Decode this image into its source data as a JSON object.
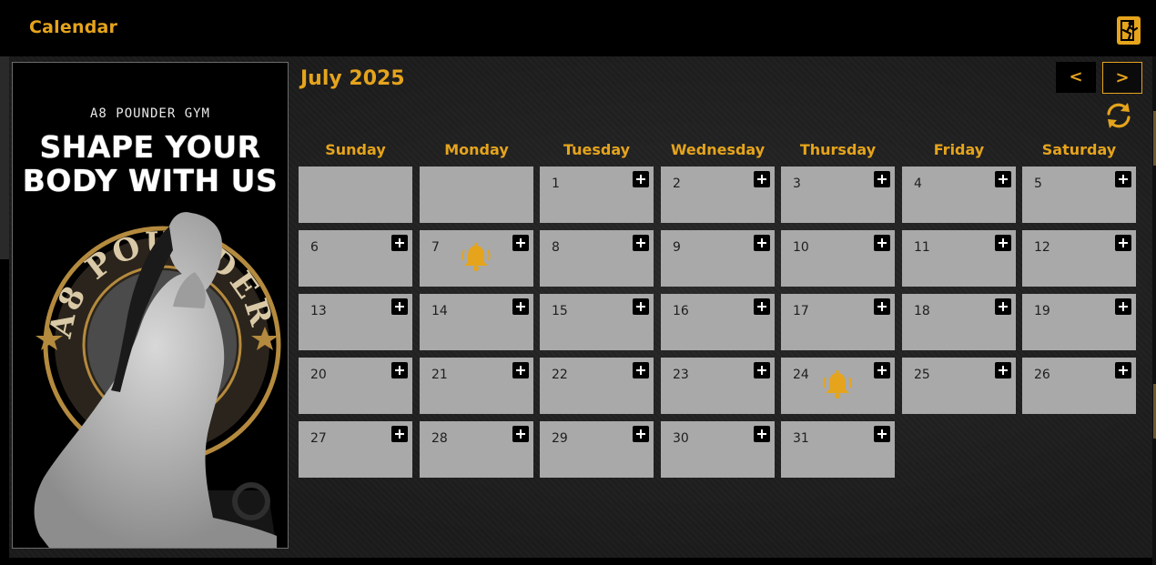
{
  "window": {
    "title": "Calendar"
  },
  "colors": {
    "accent": "#e5a41c",
    "cell": "#a9a9a9",
    "background": "#1b1b1b"
  },
  "promo": {
    "gym_name": "A8 POUNDER GYM",
    "headline_line1": "SHAPE YOUR",
    "headline_line2": "BODY WITH US",
    "emblem_text": "A8 POUNDER FITNESS GYM"
  },
  "calendar": {
    "month_label": "July 2025",
    "prev_label": "<",
    "next_label": ">",
    "weekdays": [
      "Sunday",
      "Monday",
      "Tuesday",
      "Wednesday",
      "Thursday",
      "Friday",
      "Saturday"
    ],
    "first_weekday_index": 2,
    "days_in_month": 31,
    "reminder_days": [
      7,
      24
    ],
    "icons": {
      "add": "plus-icon",
      "reminder": "bell-icon",
      "refresh": "refresh-icon",
      "exit": "exit-icon"
    }
  }
}
